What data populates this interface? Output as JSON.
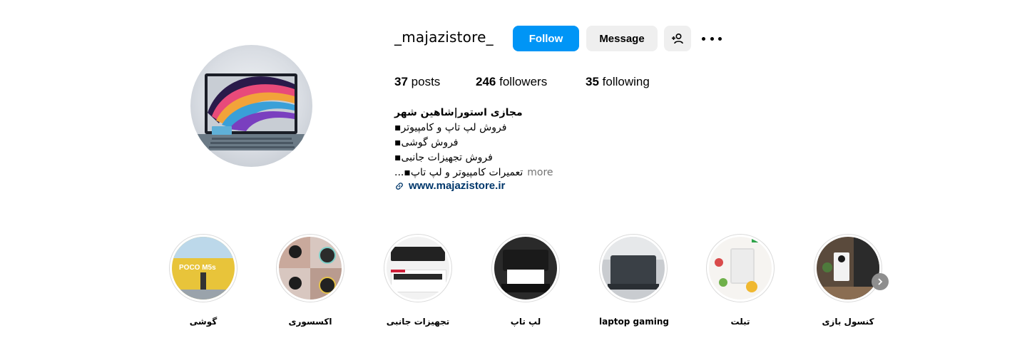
{
  "profile": {
    "username": "_majazistore_",
    "buttons": {
      "follow": "Follow",
      "message": "Message"
    },
    "stats": {
      "posts_count": "37",
      "posts_label": "posts",
      "followers_count": "246",
      "followers_label": "followers",
      "following_count": "35",
      "following_label": "following"
    },
    "bio": {
      "name": "مجازی استور|شاهین شهر",
      "lines": [
        "فروش لپ تاپ و کامپیوتر▪",
        "فروش گوشی▪",
        "فروش تجهیزات جانبی▪",
        "تعمیرات کامپیوتر و لپ تاپ▪..."
      ],
      "more": "more",
      "link": "www.majazistore.ir"
    },
    "avatar": {
      "icon": "laptop-image"
    }
  },
  "highlights": [
    {
      "label": "گوشی",
      "thumb_text": "POCO M5s"
    },
    {
      "label": "اکسسوری"
    },
    {
      "label": "تجهیزات جانبی"
    },
    {
      "label": "لپ تاپ"
    },
    {
      "label": "laptop gaming"
    },
    {
      "label": "تبلت"
    },
    {
      "label": "کنسول بازی"
    }
  ],
  "colors": {
    "follow_bg": "#0095f6",
    "secondary_bg": "#efefef",
    "link_color": "#00376b",
    "muted": "#737373"
  },
  "icons": {
    "add_user": "person-plus-icon",
    "more": "ellipsis-icon",
    "link": "link-icon",
    "next": "chevron-right-icon"
  }
}
